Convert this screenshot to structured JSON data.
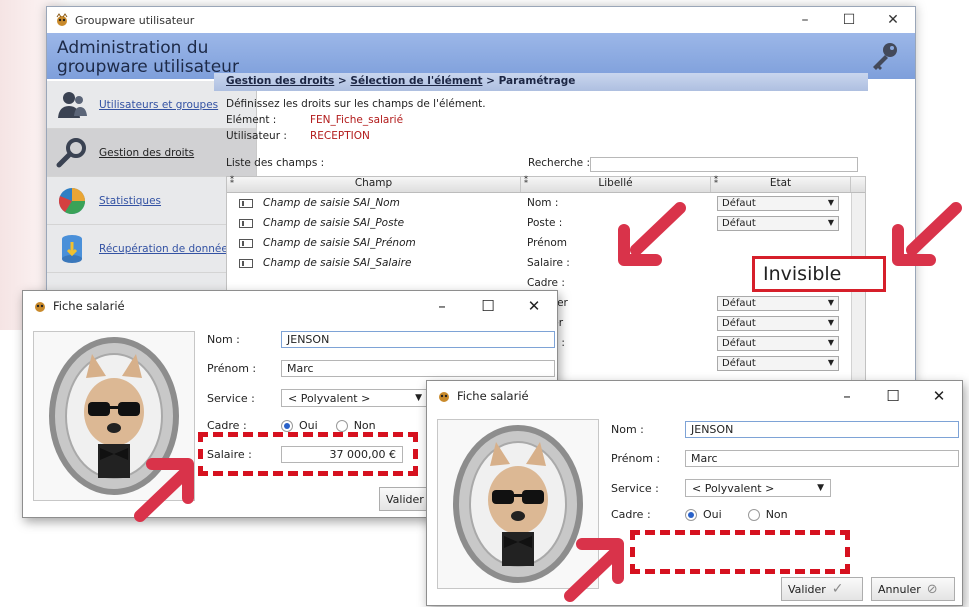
{
  "main_window": {
    "title": "Groupware utilisateur",
    "controls": {
      "minimize": "–",
      "maximize": "☐",
      "close": "✕"
    },
    "banner_title_line1": "Administration du",
    "banner_title_line2": "groupware utilisateur",
    "breadcrumb": {
      "part1": "Gestion des droits",
      "sep1": " > ",
      "part2": "Sélection de l'élément",
      "sep2": " > ",
      "part3": "Paramétrage"
    },
    "sidebar": [
      {
        "label": "Utilisateurs et groupes",
        "icon": "users-icon"
      },
      {
        "label": "Gestion des droits",
        "icon": "magnifier-icon"
      },
      {
        "label": "Statistiques",
        "icon": "pie-chart-icon"
      },
      {
        "label": "Récupération de données",
        "icon": "database-icon"
      }
    ],
    "intro": "Définissez les droits sur les champs de l'élément.",
    "element_label": "Elément :",
    "element_value": "FEN_Fiche_salarié",
    "user_label": "Utilisateur :",
    "user_value": "RECEPTION",
    "fields_list_label": "Liste des champs :",
    "search_label": "Recherche :",
    "columns": {
      "champ": "Champ",
      "libelle": "Libellé",
      "etat": "Etat"
    },
    "rows": [
      {
        "champ": "Champ de saisie SAI_Nom",
        "libelle": "Nom :",
        "etat": "Défaut"
      },
      {
        "champ": "Champ de saisie SAI_Poste",
        "libelle": "Poste :",
        "etat": "Défaut"
      },
      {
        "champ": "Champ de saisie SAI_Prénom",
        "libelle": "Prénom",
        "etat": ""
      },
      {
        "champ": "Champ de saisie SAI_Salaire",
        "libelle": "Salaire :",
        "etat": ""
      },
      {
        "champ": "",
        "libelle": "Cadre :",
        "etat": ""
      },
      {
        "champ": "",
        "libelle": "Annuler",
        "etat": "Défaut"
      },
      {
        "champ": "",
        "libelle": "Valider",
        "etat": "Défaut"
      },
      {
        "champ": "",
        "libelle": "Cadre :",
        "etat": "Défaut"
      },
      {
        "champ": "",
        "libelle": "",
        "etat": "Défaut"
      }
    ],
    "invisible_label": "Invisible"
  },
  "dialog1": {
    "title": "Fiche salarié",
    "controls": {
      "minimize": "–",
      "maximize": "☐",
      "close": "✕"
    },
    "nom_label": "Nom :",
    "nom_value": "JENSON",
    "prenom_label": "Prénom :",
    "prenom_value": "Marc",
    "service_label": "Service :",
    "service_value": "< Polyvalent >",
    "cadre_label": "Cadre :",
    "cadre_oui": "Oui",
    "cadre_non": "Non",
    "salaire_label": "Salaire :",
    "salaire_value": "37 000,00 €",
    "valider_label": "Valider"
  },
  "dialog2": {
    "title": "Fiche salarié",
    "controls": {
      "minimize": "–",
      "maximize": "☐",
      "close": "✕"
    },
    "nom_label": "Nom :",
    "nom_value": "JENSON",
    "prenom_label": "Prénom :",
    "prenom_value": "Marc",
    "service_label": "Service :",
    "service_value": "< Polyvalent >",
    "cadre_label": "Cadre :",
    "cadre_oui": "Oui",
    "cadre_non": "Non",
    "valider_label": "Valider",
    "annuler_label": "Annuler"
  },
  "colors": {
    "accent_red": "#d61f2a",
    "banner_blue": "#8aa9e0",
    "value_red": "#b21b1b"
  }
}
